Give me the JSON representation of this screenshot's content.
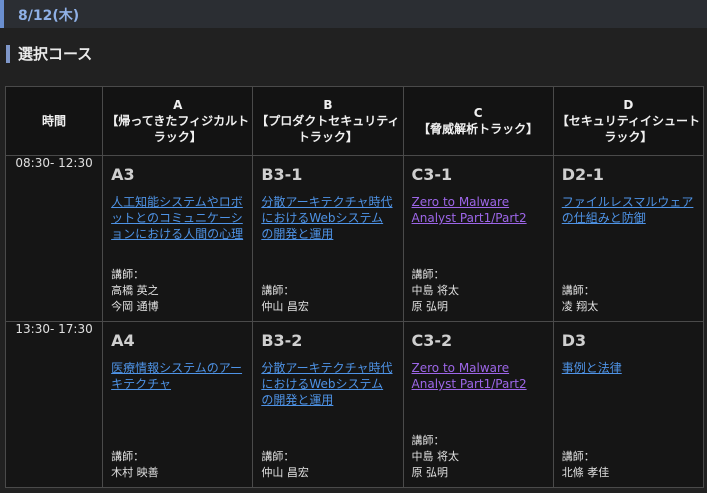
{
  "date": "8/12(木)",
  "section_title": "選択コース",
  "table": {
    "time_header": "時間",
    "columns": [
      {
        "letter": "A",
        "name": "【帰ってきたフィジカルトラック】"
      },
      {
        "letter": "B",
        "name": "【プロダクトセキュリティトラック】"
      },
      {
        "letter": "C",
        "name": "【脅威解析トラック】"
      },
      {
        "letter": "D",
        "name": "【セキュリティイシュートラック】"
      }
    ],
    "rows": [
      {
        "time": "08:30- 12:30",
        "sessions": [
          {
            "code": "A3",
            "title": "人工知能システムやロボットとのコミュニケーションにおける人間の心理",
            "speaker_label": "講師：",
            "speakers": [
              "高橋 英之",
              "今岡 通博"
            ]
          },
          {
            "code": "B3-1",
            "title": "分散アーキテクチャ時代におけるWebシステムの開発と運用",
            "speaker_label": "講師：",
            "speakers": [
              "仲山 昌宏"
            ]
          },
          {
            "code": "C3-1",
            "title": "Zero to Malware Analyst Part1/Part2",
            "speaker_label": "講師：",
            "speakers": [
              "中島 将太",
              "原 弘明"
            ]
          },
          {
            "code": "D2-1",
            "title": "ファイルレスマルウェアの仕組みと防御",
            "speaker_label": "講師：",
            "speakers": [
              "凌 翔太"
            ]
          }
        ]
      },
      {
        "time": "13:30- 17:30",
        "sessions": [
          {
            "code": "A4",
            "title": "医療情報システムのアーキテクチャ",
            "speaker_label": "講師：",
            "speakers": [
              "木村 映善"
            ]
          },
          {
            "code": "B3-2",
            "title": "分散アーキテクチャ時代におけるWebシステムの開発と運用",
            "speaker_label": "講師：",
            "speakers": [
              "仲山 昌宏"
            ]
          },
          {
            "code": "C3-2",
            "title": "Zero to Malware Analyst Part1/Part2",
            "speaker_label": "講師：",
            "speakers": [
              "中島 将太",
              "原 弘明"
            ]
          },
          {
            "code": "D3",
            "title": "事例と法律",
            "speaker_label": "講師：",
            "speakers": [
              "北條 孝佳"
            ]
          }
        ]
      }
    ]
  },
  "colors": {
    "link": "#4e93e6",
    "visited_link": "#9d66e8",
    "accent": "#6a8fd0"
  }
}
